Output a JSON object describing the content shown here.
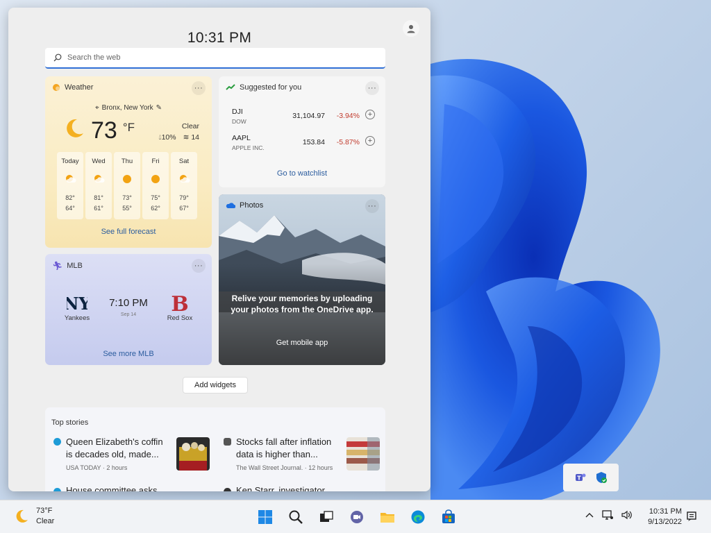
{
  "board": {
    "time": "10:31 PM",
    "search_placeholder": "Search the web",
    "add_widgets_label": "Add widgets"
  },
  "weather": {
    "title": "Weather",
    "location": "Bronx, New York",
    "temp": "73",
    "unit": "°F",
    "condition": "Clear",
    "precip": "10%",
    "wind": "14",
    "days": [
      {
        "name": "Today",
        "icon": "partly-cloudy-icon",
        "hi": "82°",
        "lo": "64°"
      },
      {
        "name": "Wed",
        "icon": "partly-cloudy-icon",
        "hi": "81°",
        "lo": "61°"
      },
      {
        "name": "Thu",
        "icon": "sun-icon",
        "hi": "73°",
        "lo": "55°"
      },
      {
        "name": "Fri",
        "icon": "sun-icon",
        "hi": "75°",
        "lo": "62°"
      },
      {
        "name": "Sat",
        "icon": "partly-cloudy-icon",
        "hi": "79°",
        "lo": "67°"
      }
    ],
    "forecast_link": "See full forecast"
  },
  "stocks": {
    "title": "Suggested for you",
    "items": [
      {
        "symbol": "DJI",
        "name": "DOW",
        "price": "31,104.97",
        "change": "-3.94%"
      },
      {
        "symbol": "AAPL",
        "name": "APPLE INC.",
        "price": "153.84",
        "change": "-5.87%"
      }
    ],
    "watchlist_link": "Go to watchlist",
    "negative_color": "#c0392b"
  },
  "photos": {
    "title": "Photos",
    "message": "Relive your memories by uploading your photos from the OneDrive app.",
    "cta": "Get mobile app"
  },
  "mlb": {
    "title": "MLB",
    "home_team": "Yankees",
    "away_team": "Red Sox",
    "time": "7:10 PM",
    "date": "Sep 14",
    "more_link": "See more MLB"
  },
  "top_stories": {
    "title": "Top stories",
    "items": [
      {
        "title": "Queen Elizabeth's coffin is decades old, made...",
        "source": "USA TODAY",
        "age": "2 hours"
      },
      {
        "title": "Stocks fall after inflation data is higher than...",
        "source": "The Wall Street Journal.",
        "age": "12 hours"
      }
    ],
    "next_items": [
      {
        "title": "House committee asks"
      },
      {
        "title": "Ken Starr, investigator"
      }
    ]
  },
  "taskbar": {
    "weather_temp": "73°F",
    "weather_cond": "Clear",
    "time": "10:31 PM",
    "date": "9/13/2022",
    "apps": [
      "windows-start-icon",
      "search-icon",
      "task-view-icon",
      "teams-chat-icon",
      "file-explorer-icon",
      "edge-icon",
      "store-icon"
    ]
  },
  "colors": {
    "accent": "#2f6fd6",
    "link": "#2b5c9e",
    "wallpaper_blue": "#1a4fd8"
  }
}
